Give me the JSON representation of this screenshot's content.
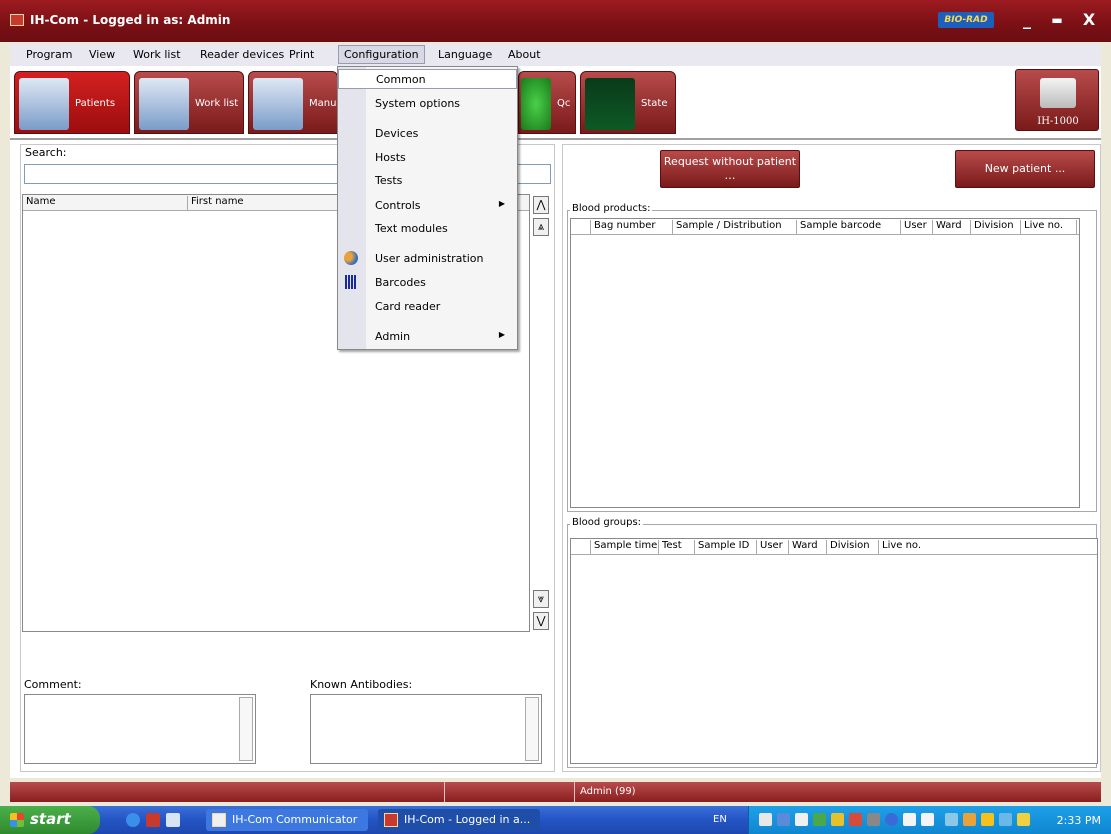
{
  "window": {
    "title": "IH-Com - Logged in as: Admin",
    "brand": "BIO-RAD",
    "minimize": "_",
    "maximize": "▬",
    "close": "X"
  },
  "menubar": [
    "Program",
    "View",
    "Work list",
    "Reader devices",
    "Print",
    "Configuration",
    "Language",
    "About"
  ],
  "tabs": [
    {
      "label": "Patients",
      "icon": "patients-icon"
    },
    {
      "label": "Work list",
      "icon": "worklist-icon"
    },
    {
      "label": "Manu",
      "icon": "manual-icon"
    },
    {
      "label": "Qc",
      "icon": "qc-icon"
    },
    {
      "label": "State",
      "icon": "state-icon"
    }
  ],
  "device_button": {
    "label": "IH-1000"
  },
  "left_panel": {
    "search_label": "Search:",
    "search_value": "",
    "columns": [
      "Name",
      "First name"
    ],
    "scroll": {
      "top": "⋀",
      "page_up": "⩓",
      "page_down": "⩔",
      "bottom": "⋁"
    },
    "comment_label": "Comment:",
    "antibodies_label": "Known Antibodies:"
  },
  "right_panel": {
    "request_button": "Request without patient …",
    "new_patient_button": "New patient ...",
    "blood_products": {
      "label": "Blood products:",
      "columns": [
        "Bag number",
        "Sample / Distribution",
        "Sample barcode",
        "User",
        "Ward",
        "Division",
        "Live no."
      ]
    },
    "blood_groups": {
      "label": "Blood groups:",
      "columns": [
        "Sample time",
        "Test",
        "Sample ID",
        "User",
        "Ward",
        "Division",
        "Live no."
      ]
    }
  },
  "dropdown": {
    "items": [
      {
        "label": "Common",
        "highlight": true
      },
      {
        "label": "System options"
      },
      {
        "label": "Devices"
      },
      {
        "label": "Hosts"
      },
      {
        "label": "Tests"
      },
      {
        "label": "Controls",
        "submenu": true
      },
      {
        "label": "Text modules"
      },
      {
        "label": "User administration",
        "icon": "users-icon"
      },
      {
        "label": "Barcodes",
        "icon": "barcode-icon"
      },
      {
        "label": "Card reader"
      },
      {
        "label": "Admin",
        "submenu": true
      }
    ],
    "submenu_arrow": "▶"
  },
  "statusbar": {
    "user": "Admin (99)"
  },
  "taskbar": {
    "start": "start",
    "items": [
      "IH-Com Communicator",
      "IH-Com - Logged in a..."
    ],
    "language": "EN",
    "clock": "2:33 PM"
  }
}
